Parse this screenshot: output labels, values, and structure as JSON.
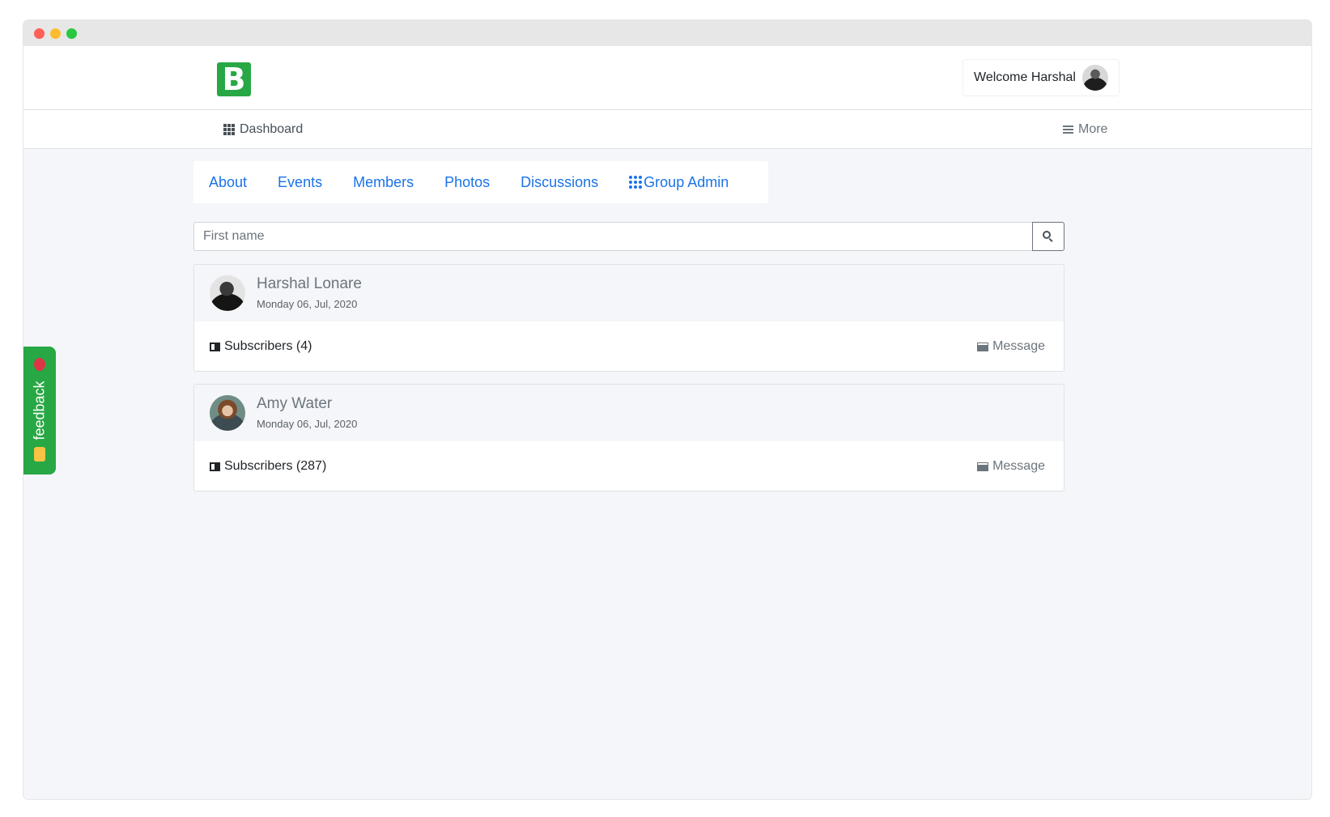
{
  "header": {
    "logo_letter": "B",
    "welcome_text": "Welcome Harshal"
  },
  "navbar": {
    "dashboard_label": "Dashboard",
    "more_label": "More"
  },
  "tabs": [
    {
      "label": "About"
    },
    {
      "label": "Events"
    },
    {
      "label": "Members"
    },
    {
      "label": "Photos"
    },
    {
      "label": "Discussions"
    },
    {
      "label": "Group Admin"
    }
  ],
  "search": {
    "placeholder": "First name"
  },
  "members": [
    {
      "name": "Harshal Lonare",
      "date": "Monday 06, Jul, 2020",
      "subscribers": "Subscribers (4)",
      "message_label": "Message"
    },
    {
      "name": "Amy Water",
      "date": "Monday 06, Jul, 2020",
      "subscribers": "Subscribers (287)",
      "message_label": "Message"
    }
  ],
  "feedback": {
    "label": "feedback"
  },
  "colors": {
    "brand_green": "#28a745",
    "link_blue": "#1a73e8",
    "page_bg": "#f5f6f9"
  }
}
